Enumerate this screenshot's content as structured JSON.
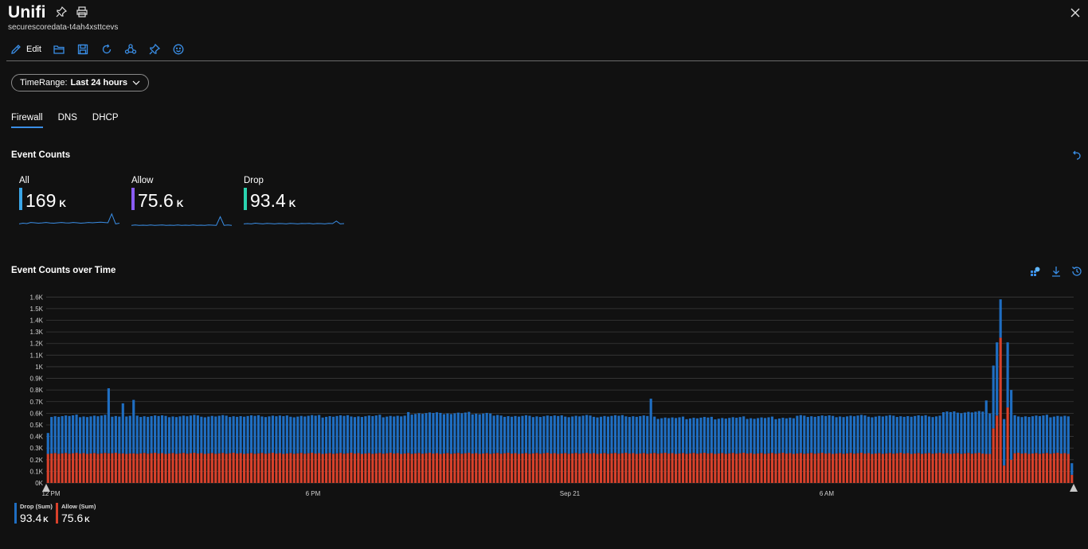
{
  "header": {
    "title": "Unifi",
    "subtitle": "securescoredata-t4ah4xsttcevs",
    "pin_icon": "pin-icon",
    "print_icon": "print-icon",
    "close_icon": "close-icon"
  },
  "toolbar": {
    "edit_label": "Edit",
    "icons": [
      "edit-icon",
      "open-folder-icon",
      "save-icon",
      "refresh-icon",
      "share-icon",
      "pin-icon",
      "feedback-smiley-icon"
    ]
  },
  "filter": {
    "param_label": "TimeRange:",
    "param_value": "Last 24 hours"
  },
  "tabs": [
    {
      "label": "Firewall",
      "active": true
    },
    {
      "label": "DNS",
      "active": false
    },
    {
      "label": "DHCP",
      "active": false
    }
  ],
  "event_counts": {
    "title": "Event Counts",
    "kpis": [
      {
        "label": "All",
        "value": "169",
        "unit": "K",
        "color": "#3aa6e8",
        "spark": [
          0.2,
          0.25,
          0.22,
          0.3,
          0.28,
          0.25,
          0.27,
          0.3,
          0.26,
          0.25,
          0.28,
          0.3,
          0.27,
          0.26,
          0.3,
          0.28,
          0.25,
          0.27,
          0.3,
          0.28,
          0.3,
          0.32,
          0.3,
          0.28,
          0.9,
          0.2,
          0.25
        ]
      },
      {
        "label": "Allow",
        "value": "75.6",
        "unit": "K",
        "color": "#8a5cf6",
        "spark": [
          0.1,
          0.12,
          0.1,
          0.11,
          0.1,
          0.12,
          0.1,
          0.11,
          0.12,
          0.1,
          0.11,
          0.1,
          0.12,
          0.1,
          0.11,
          0.1,
          0.12,
          0.1,
          0.11,
          0.1,
          0.12,
          0.11,
          0.1,
          0.7,
          0.1,
          0.12,
          0.1
        ]
      },
      {
        "label": "Drop",
        "value": "93.4",
        "unit": "K",
        "color": "#2ad4b0",
        "spark": [
          0.2,
          0.22,
          0.2,
          0.25,
          0.22,
          0.2,
          0.24,
          0.22,
          0.2,
          0.23,
          0.22,
          0.2,
          0.24,
          0.22,
          0.2,
          0.23,
          0.22,
          0.24,
          0.2,
          0.23,
          0.22,
          0.2,
          0.24,
          0.22,
          0.4,
          0.2,
          0.22
        ]
      }
    ]
  },
  "over_time": {
    "title": "Event Counts over Time",
    "icons": [
      "customize-icon",
      "download-icon",
      "history-icon"
    ]
  },
  "colors": {
    "drop": "#1f6ec2",
    "allow": "#d8412b",
    "accent": "#3a8ee6",
    "grid": "#3a3a3a"
  },
  "chart_data": {
    "type": "bar",
    "stacked": true,
    "y_ticks": [
      "1.6K",
      "1.5K",
      "1.4K",
      "1.3K",
      "1.2K",
      "1.1K",
      "1K",
      "0.9K",
      "0.8K",
      "0.7K",
      "0.6K",
      "0.5K",
      "0.4K",
      "0.3K",
      "0.2K",
      "0.1K",
      "0K"
    ],
    "ylim": [
      0,
      1650
    ],
    "x_ticks": [
      "12 PM",
      "6 PM",
      "Sep 21",
      "6 AM"
    ],
    "grid": true,
    "legend_placement": "bottom-left",
    "series": [
      {
        "name": "Drop (Sum)",
        "total": "93.4",
        "unit": "K",
        "color": "#1f6ec2"
      },
      {
        "name": "Allow (Sum)",
        "total": "75.6",
        "unit": "K",
        "color": "#d8412b"
      }
    ],
    "bar_count": 288,
    "allow_baseline": 255,
    "drop_baseline": 320,
    "notable_totals": [
      {
        "index": 0,
        "drop": 180,
        "allow": 250
      },
      {
        "index": 17,
        "drop": 560,
        "allow": 255
      },
      {
        "index": 21,
        "drop": 430,
        "allow": 255
      },
      {
        "index": 24,
        "drop": 460,
        "allow": 255
      },
      {
        "index": 169,
        "drop": 470,
        "allow": 255
      },
      {
        "index": 263,
        "drop": 460,
        "allow": 250
      },
      {
        "index": 265,
        "drop": 540,
        "allow": 470
      },
      {
        "index": 266,
        "drop": 630,
        "allow": 580
      },
      {
        "index": 267,
        "drop": 330,
        "allow": 1250
      },
      {
        "index": 268,
        "drop": 400,
        "allow": 150
      },
      {
        "index": 269,
        "drop": 560,
        "allow": 650
      },
      {
        "index": 270,
        "drop": 600,
        "allow": 200
      },
      {
        "index": 287,
        "drop": 100,
        "allow": 70
      }
    ]
  }
}
